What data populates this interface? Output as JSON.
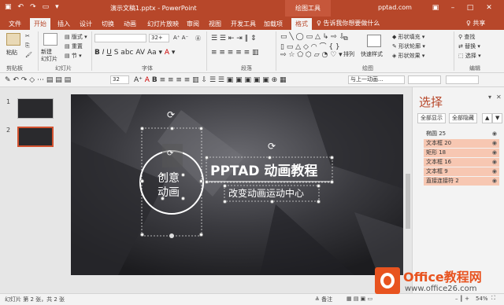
{
  "titlebar": {
    "doc_title": "演示文稿1.pptx - PowerPoint",
    "context_group": "绘图工具",
    "account": "pptad.com"
  },
  "tabs": {
    "file": "文件",
    "home": "开始",
    "insert": "插入",
    "design": "设计",
    "transitions": "切换",
    "animations": "动画",
    "slideshow": "幻灯片放映",
    "review": "审阅",
    "view": "视图",
    "developer": "开发工具",
    "addins": "加载项",
    "format": "格式",
    "tellme": "♀ 告诉我你想要做什么",
    "share": "♀ 共享"
  },
  "ribbon": {
    "paste": "粘贴",
    "cut": "剪切",
    "copy": "复制",
    "format_painter": "格式刷",
    "clipboard": "剪贴板",
    "new_slide": "新建\n幻灯片",
    "layout": "版式",
    "reset": "重置",
    "section": "节",
    "slides": "幻灯片",
    "font_size": "32+",
    "font_group": "字体",
    "paragraph": "段落",
    "arrange": "排列",
    "quick_styles": "快速样式",
    "shape_fill": "形状填充",
    "shape_outline": "形状轮廓",
    "shape_effects": "形状效果",
    "drawing": "绘图",
    "find": "查找",
    "replace": "替换",
    "select": "选择",
    "editing": "编辑"
  },
  "toolbar2": {
    "font_size": "32",
    "align_label": "与上一动画..."
  },
  "slides": {
    "num1": "1",
    "num2": "2"
  },
  "slide": {
    "title": "PPTAD  动画教程",
    "subtitle": "改变动画运动中心",
    "circle_line1": "创意",
    "circle_line2": "动画"
  },
  "selection_pane": {
    "title": "选择",
    "show_all": "全部显示",
    "hide_all": "全部隐藏",
    "items": [
      {
        "label": "椭圆 25",
        "highlight": false
      },
      {
        "label": "文本框 20",
        "highlight": true
      },
      {
        "label": "矩形 18",
        "highlight": true
      },
      {
        "label": "文本框 16",
        "highlight": true
      },
      {
        "label": "文本框 9",
        "highlight": true
      },
      {
        "label": "直接连接符 2",
        "highlight": true
      }
    ]
  },
  "status": {
    "slide_info": "幻灯片 第 2 张，共 2 张",
    "notes": "备注",
    "zoom": "54%"
  },
  "watermark": {
    "brand": "Office教程网",
    "url": "www.office26.com"
  },
  "colors": {
    "accent": "#b7472a",
    "highlight": "#f7c7b2"
  }
}
